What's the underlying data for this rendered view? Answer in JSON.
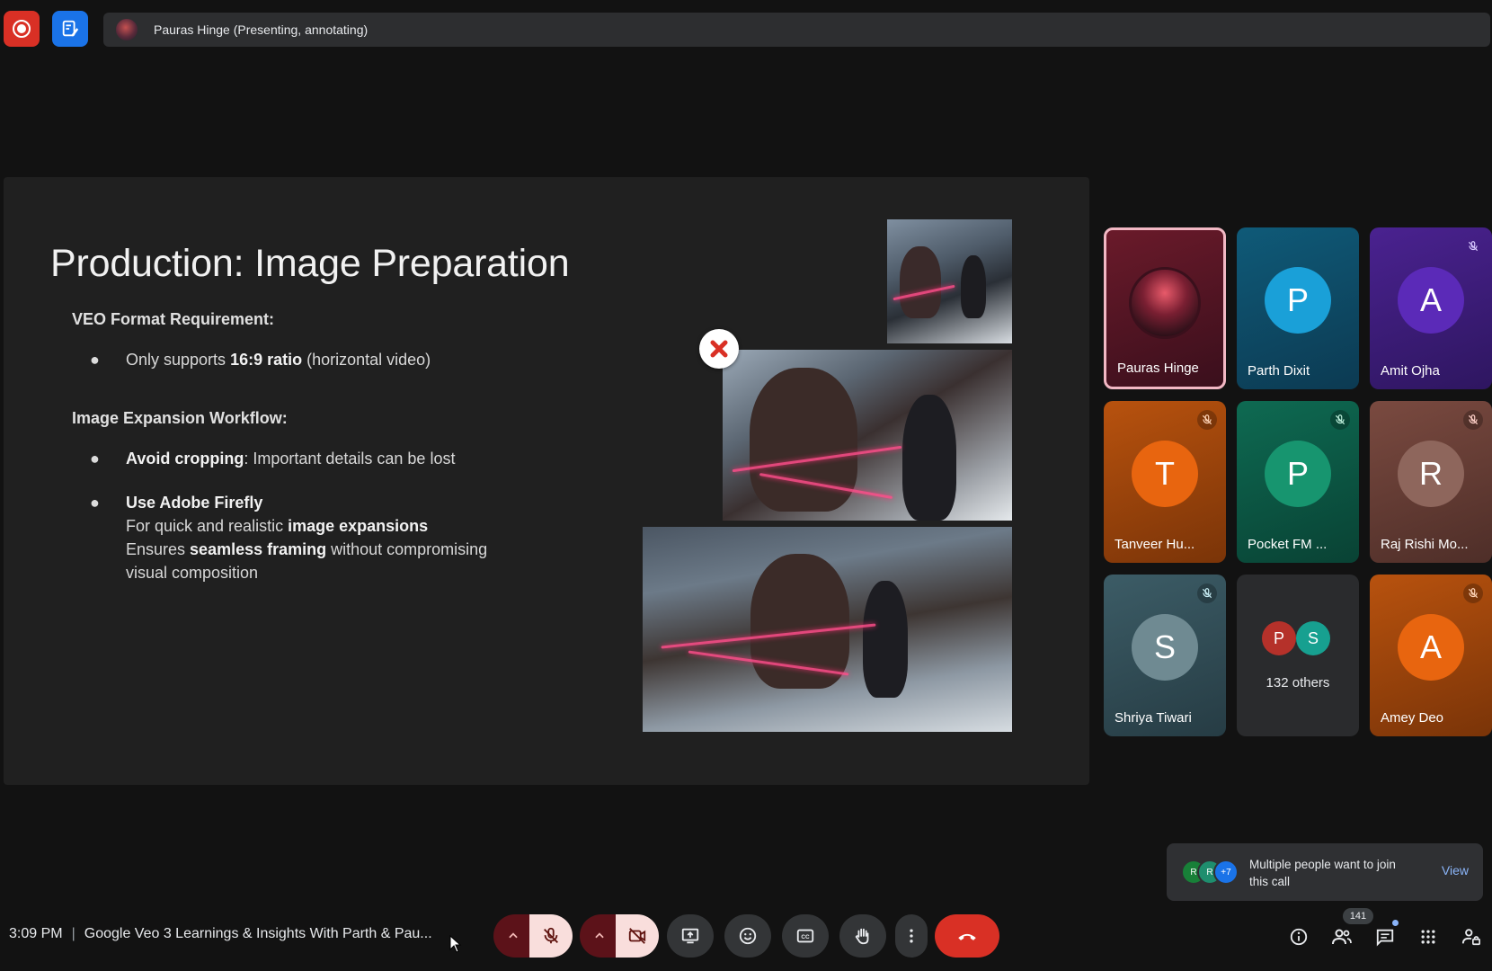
{
  "top_bar": {
    "presenter_label": "Pauras Hinge (Presenting, annotating)"
  },
  "slide": {
    "title": "Production: Image Preparation",
    "section1_heading": "VEO Format Requirement:",
    "section1_bullet_pre": "Only supports ",
    "section1_bullet_bold": "16:9 ratio",
    "section1_bullet_post": " (horizontal video)",
    "section2_heading": "Image Expansion Workflow:",
    "bullet2_bold": "Avoid cropping",
    "bullet2_rest": ": Important details can be lost",
    "bullet3_bold": "Use Adobe Firefly",
    "bullet3_line1_pre": "For quick and realistic ",
    "bullet3_line1_bold": "image expansions",
    "bullet3_line2_pre": "Ensures ",
    "bullet3_line2_bold": "seamless framing",
    "bullet3_line2_post": " without compromising",
    "bullet3_line3": "visual composition",
    "bullet_glyph": "●"
  },
  "participants": [
    {
      "name": "Pauras Hinge",
      "initial": "",
      "color": "#5a1a2a",
      "muted": false,
      "active": true
    },
    {
      "name": "Parth Dixit",
      "initial": "P",
      "color": "#0e6a8a",
      "muted": false
    },
    {
      "name": "Amit Ojha",
      "initial": "A",
      "color": "#5b2aa8",
      "muted": true
    },
    {
      "name": "Tanveer Hu...",
      "initial": "T",
      "color": "#c4580f",
      "muted": true
    },
    {
      "name": "Pocket FM ...",
      "initial": "P",
      "color": "#0f7a5f",
      "muted": true
    },
    {
      "name": "Raj Rishi Mo...",
      "initial": "R",
      "color": "#7a4a40",
      "muted": true
    },
    {
      "name": "Shriya Tiwari",
      "initial": "S",
      "color": "#3c5a62",
      "muted": true
    },
    {
      "others_label": "132 others",
      "mini": [
        "P",
        "S"
      ]
    },
    {
      "name": "Amey Deo",
      "initial": "A",
      "color": "#c4580f",
      "muted": true
    }
  ],
  "notification": {
    "text": "Multiple people want to join this call",
    "view_label": "View",
    "avatar_initials": [
      "R",
      "R",
      "+7"
    ]
  },
  "bottom_bar": {
    "time": "3:09 PM",
    "separator": "|",
    "meeting_title": "Google Veo 3 Learnings & Insights With Parth & Pau...",
    "people_count": "141"
  },
  "colors": {
    "accent_red": "#d93025",
    "accent_blue": "#1a73e8",
    "link_blue": "#8ab4f8"
  }
}
